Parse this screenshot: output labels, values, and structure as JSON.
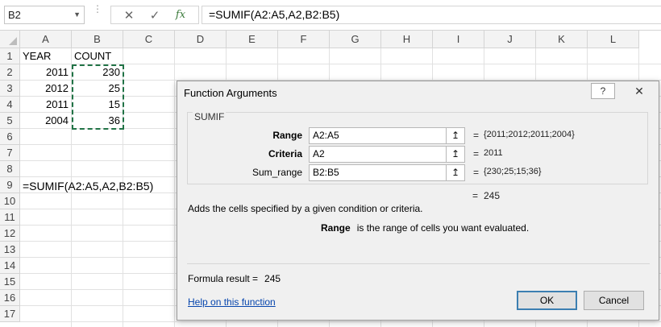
{
  "formula_bar": {
    "name_box": "B2",
    "cancel_glyph": "✕",
    "enter_glyph": "✓",
    "fx_label": "fx",
    "formula": "=SUMIF(A2:A5,A2,B2:B5)"
  },
  "columns": [
    "A",
    "B",
    "C",
    "D",
    "E",
    "F",
    "G",
    "H",
    "I",
    "J",
    "K",
    "L"
  ],
  "rows": [
    "1",
    "2",
    "3",
    "4",
    "5",
    "6",
    "7",
    "8",
    "9",
    "10",
    "11",
    "12",
    "13",
    "14",
    "15",
    "16",
    "17"
  ],
  "cells": {
    "A1": "YEAR",
    "B1": "COUNT",
    "A2": "2011",
    "B2": "230",
    "A3": "2012",
    "B3": "25",
    "A4": "2011",
    "B4": "15",
    "A5": "2004",
    "B5": "36",
    "A9": "=SUMIF(A2:A5,A2,B2:B5)"
  },
  "dialog": {
    "title": "Function Arguments",
    "help_glyph": "?",
    "close_glyph": "✕",
    "function_name": "SUMIF",
    "args": [
      {
        "label": "Range",
        "value": "A2:A5",
        "result": "{2011;2012;2011;2004}"
      },
      {
        "label": "Criteria",
        "value": "A2",
        "result": "2011"
      },
      {
        "label": "Sum_range",
        "value": "B2:B5",
        "result": "{230;25;15;36}"
      }
    ],
    "result_eq": "=",
    "result_value": "245",
    "description": "Adds the cells specified by a given condition or criteria.",
    "arg_desc_name": "Range",
    "arg_desc_text": "is the range of cells you want evaluated.",
    "formula_result_label": "Formula result =",
    "formula_result_value": "245",
    "help_link": "Help on this function",
    "ok_label": "OK",
    "cancel_label": "Cancel",
    "ref_glyph": "↥"
  }
}
